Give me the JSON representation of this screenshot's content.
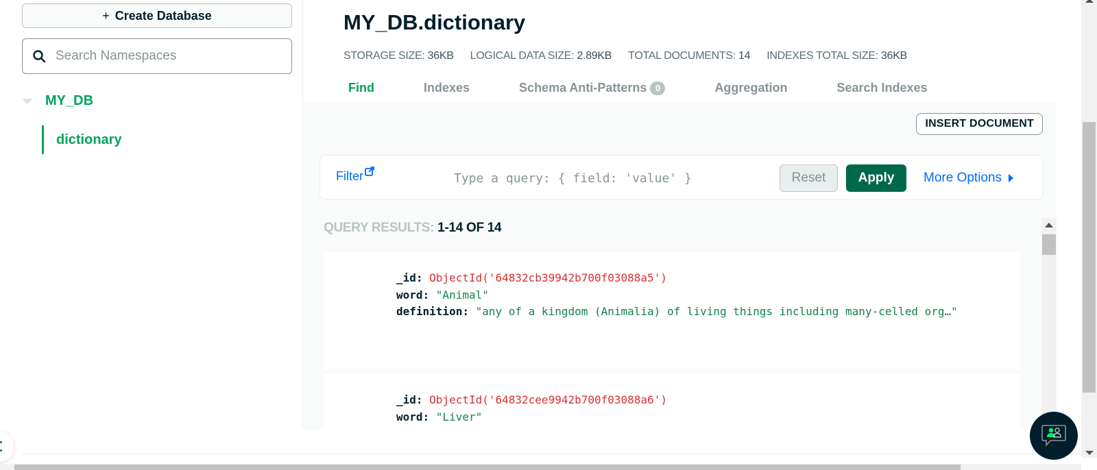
{
  "sidebar": {
    "create_db_label": "Create Database",
    "search_placeholder": "Search Namespaces",
    "database": "MY_DB",
    "collection": "dictionary"
  },
  "header": {
    "title": "MY_DB.dictionary",
    "stats": [
      {
        "label": "STORAGE SIZE:",
        "value": "36KB"
      },
      {
        "label": "LOGICAL DATA SIZE:",
        "value": "2.89KB"
      },
      {
        "label": "TOTAL DOCUMENTS:",
        "value": "14"
      },
      {
        "label": "INDEXES TOTAL SIZE:",
        "value": "36KB"
      }
    ],
    "tabs": [
      {
        "label": "Find",
        "active": true
      },
      {
        "label": "Indexes"
      },
      {
        "label": "Schema Anti-Patterns",
        "badge": "0"
      },
      {
        "label": "Aggregation"
      },
      {
        "label": "Search Indexes"
      }
    ]
  },
  "toolbar": {
    "insert_label": "INSERT DOCUMENT",
    "filter_label": "Filter",
    "query_placeholder": "Type a query: { field: 'value' }",
    "reset_label": "Reset",
    "apply_label": "Apply",
    "more_options_label": "More Options"
  },
  "results": {
    "label": "QUERY RESULTS:",
    "count": "1-14 OF 14",
    "documents": [
      {
        "id_key": "_id: ",
        "id_value": "ObjectId('64832cb39942b700f03088a5')",
        "word_key": "word: ",
        "word_value": "\"Animal\"",
        "def_key": "definition: ",
        "def_value": "\"any of a kingdom (Animalia) of living things including many-celled org…\""
      },
      {
        "id_key": "_id: ",
        "id_value": "ObjectId('64832cee9942b700f03088a6')",
        "word_key": "word: ",
        "word_value": "\"Liver\""
      }
    ]
  },
  "colors": {
    "brand_green": "#00a35c",
    "apply_green": "#00684a",
    "link_blue": "#016bf8",
    "oid_red": "#db3030",
    "string_green": "#12824d"
  }
}
